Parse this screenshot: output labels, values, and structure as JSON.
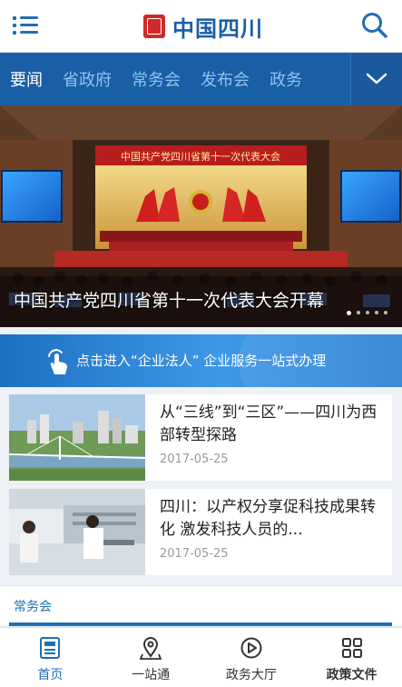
{
  "header": {
    "title": "中国四川",
    "menu_icon": "menu-icon",
    "search_icon": "search-icon",
    "logo_icon": "seal-logo-icon"
  },
  "nav": {
    "tabs": [
      "要闻",
      "省政府",
      "常务会",
      "发布会",
      "政务"
    ],
    "active_tab": "要闻",
    "more_icon": "chevron-down-icon"
  },
  "hero": {
    "caption": "中国共产党四川省第十一次代表大会开幕",
    "banner_text": "中国共产党四川省第十一次代表大会",
    "slide_count": 5,
    "active_slide": 1
  },
  "banner": {
    "text": "点击进入“企业法人” 企业服务一站式办理",
    "icon": "tap-hand-icon"
  },
  "news": [
    {
      "title": "从“三线”到“三区”——四川为西部转型探路",
      "date": "2017-05-25"
    },
    {
      "title": "四川：以产权分享促科技成果转化 激发科技人员的...",
      "date": "2017-05-25"
    }
  ],
  "section": {
    "label": "常务会"
  },
  "bottom_nav": {
    "items": [
      {
        "label": "首页",
        "icon": "home-doc-icon"
      },
      {
        "label": "一站通",
        "icon": "location-pin-icon"
      },
      {
        "label": "政务大厅",
        "icon": "play-circle-icon"
      },
      {
        "label": "政策文件",
        "icon": "grid-icon"
      }
    ],
    "active": "首页"
  },
  "colors": {
    "brand_blue": "#1f6fb6",
    "nav_blue": "#195fa6",
    "seal_red": "#d12a2a"
  }
}
